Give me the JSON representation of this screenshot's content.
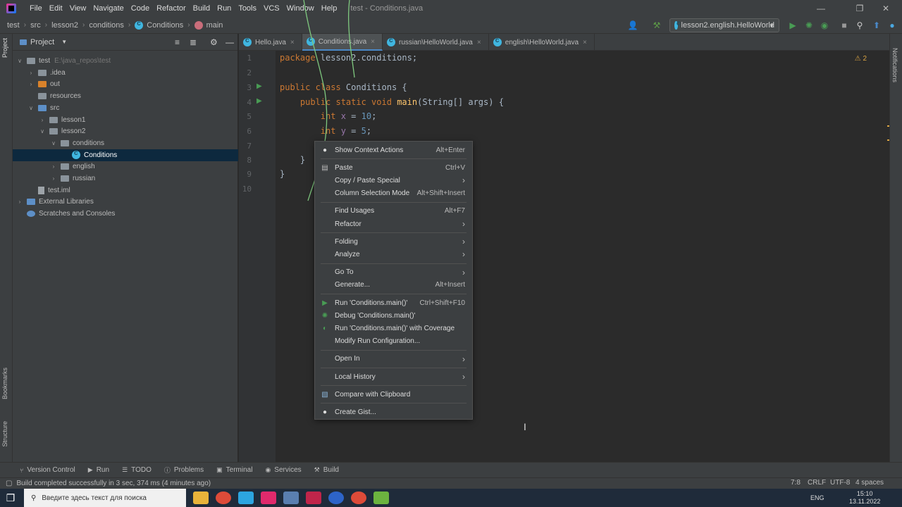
{
  "menubar": {
    "items": [
      "File",
      "Edit",
      "View",
      "Navigate",
      "Code",
      "Refactor",
      "Build",
      "Run",
      "Tools",
      "VCS",
      "Window",
      "Help"
    ],
    "title": "test - Conditions.java"
  },
  "breadcrumb": [
    "test",
    "src",
    "lesson2",
    "conditions",
    "Conditions",
    "main"
  ],
  "toolbar": {
    "run_config": "lesson2.english.HelloWorld"
  },
  "project": {
    "title": "Project",
    "tree": [
      {
        "label": "test",
        "suffix": "E:\\java_repos\\test",
        "depth": 0,
        "open": true,
        "icon": "module-folder"
      },
      {
        "label": ".idea",
        "depth": 1,
        "open": false,
        "icon": "folder"
      },
      {
        "label": "out",
        "depth": 1,
        "open": false,
        "icon": "folder-orange"
      },
      {
        "label": "resources",
        "depth": 1,
        "icon": "folder"
      },
      {
        "label": "src",
        "depth": 1,
        "open": true,
        "icon": "folder-src"
      },
      {
        "label": "lesson1",
        "depth": 2,
        "open": false,
        "icon": "folder"
      },
      {
        "label": "lesson2",
        "depth": 2,
        "open": true,
        "icon": "folder"
      },
      {
        "label": "conditions",
        "depth": 3,
        "open": true,
        "icon": "folder"
      },
      {
        "label": "Conditions",
        "depth": 4,
        "icon": "class",
        "selected": true
      },
      {
        "label": "english",
        "depth": 3,
        "open": false,
        "icon": "folder"
      },
      {
        "label": "russian",
        "depth": 3,
        "open": false,
        "icon": "folder"
      },
      {
        "label": "test.iml",
        "depth": 1,
        "icon": "file"
      },
      {
        "label": "External Libraries",
        "depth": 0,
        "open": false,
        "icon": "library"
      },
      {
        "label": "Scratches and Consoles",
        "depth": 0,
        "icon": "scratch"
      }
    ]
  },
  "tabs": [
    "Hello.java",
    "Conditions.java",
    "russian\\HelloWorld.java",
    "english\\HelloWorld.java"
  ],
  "editor": {
    "line_numbers": [
      "1",
      "2",
      "3",
      "4",
      "5",
      "6",
      "7",
      "8",
      "9",
      "10"
    ],
    "warnings": "2"
  },
  "context_menu": [
    {
      "label": "Show Context Actions",
      "shortcut": "Alt+Enter",
      "icon": "bulb-icon"
    },
    {
      "sep": true
    },
    {
      "label": "Paste",
      "shortcut": "Ctrl+V",
      "icon": "clipboard-icon"
    },
    {
      "label": "Copy / Paste Special",
      "sub": true
    },
    {
      "label": "Column Selection Mode",
      "shortcut": "Alt+Shift+Insert"
    },
    {
      "sep": true
    },
    {
      "label": "Find Usages",
      "shortcut": "Alt+F7"
    },
    {
      "label": "Refactor",
      "sub": true
    },
    {
      "sep": true
    },
    {
      "label": "Folding",
      "sub": true
    },
    {
      "label": "Analyze",
      "sub": true
    },
    {
      "sep": true
    },
    {
      "label": "Go To",
      "sub": true
    },
    {
      "label": "Generate...",
      "shortcut": "Alt+Insert"
    },
    {
      "sep": true
    },
    {
      "label": "Run 'Conditions.main()'",
      "shortcut": "Ctrl+Shift+F10",
      "icon": "run-icon"
    },
    {
      "label": "Debug 'Conditions.main()'",
      "icon": "debug-icon"
    },
    {
      "label": "Run 'Conditions.main()' with Coverage",
      "icon": "coverage-icon"
    },
    {
      "label": "Modify Run Configuration..."
    },
    {
      "sep": true
    },
    {
      "label": "Open In",
      "sub": true
    },
    {
      "sep": true
    },
    {
      "label": "Local History",
      "sub": true
    },
    {
      "sep": true
    },
    {
      "label": "Compare with Clipboard",
      "icon": "compare-icon"
    },
    {
      "sep": true
    },
    {
      "label": "Create Gist...",
      "icon": "github-icon"
    }
  ],
  "side_tabs": {
    "project": "Project",
    "bookmarks": "Bookmarks",
    "structure": "Structure",
    "notifications": "Notifications"
  },
  "bottom_tools": [
    "Version Control",
    "Run",
    "TODO",
    "Problems",
    "Terminal",
    "Services",
    "Build"
  ],
  "status": {
    "message": "Build completed successfully in 3 sec, 374 ms (4 minutes ago)",
    "position": "7:8",
    "line_sep": "CRLF",
    "encoding": "UTF-8",
    "indent": "4 spaces"
  },
  "taskbar": {
    "search_placeholder": "Введите здесь текст для поиска",
    "lang": "ENG",
    "time": "15:10",
    "date": "13.11.2022"
  }
}
